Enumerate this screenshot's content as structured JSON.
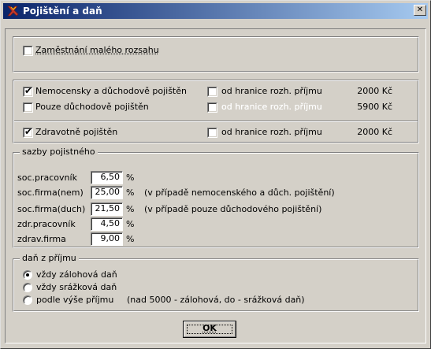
{
  "window": {
    "title": "Pojištění a daň",
    "close_label": "✕"
  },
  "small_scope": {
    "label": "Zaměstnání malého rozsahu",
    "checked": false
  },
  "insurance": {
    "sickness_pension": {
      "label": "Nemocensky a důchodově pojištěn",
      "checked": true
    },
    "sickness_threshold": {
      "label": "od hranice rozh. příjmu",
      "checked": false,
      "amount": "2000 Kč"
    },
    "pension_only": {
      "label": "Pouze důchodově pojištěn",
      "checked": false
    },
    "pension_threshold": {
      "label": "od hranice rozh. příjmu",
      "checked": false,
      "amount": "5900 Kč"
    },
    "health": {
      "label": "Zdravotně pojištěn",
      "checked": true
    },
    "health_threshold": {
      "label": "od hranice rozh. příjmu",
      "checked": false,
      "amount": "2000 Kč"
    }
  },
  "rates": {
    "legend": "sazby pojistného",
    "rows": [
      {
        "label": "soc.pracovník",
        "value": "6,50",
        "unit": "%",
        "note": ""
      },
      {
        "label": "soc.firma(nem)",
        "value": "25,00",
        "unit": "%",
        "note": "(v případě nemocenského a důch. pojištění)"
      },
      {
        "label": "soc.firma(duch)",
        "value": "21,50",
        "unit": "%",
        "note": "(v případě pouze důchodového pojištění)"
      },
      {
        "label": "zdr.pracovník",
        "value": "4,50",
        "unit": "%",
        "note": ""
      },
      {
        "label": "zdrav.firma",
        "value": "9,00",
        "unit": "%",
        "note": ""
      }
    ]
  },
  "income_tax": {
    "legend": "daň z příjmu",
    "options": [
      {
        "label": "vždy zálohová daň",
        "selected": true,
        "note": ""
      },
      {
        "label": "vždy srážková daň",
        "selected": false,
        "note": ""
      },
      {
        "label": "podle výše příjmu",
        "selected": false,
        "note": "(nad 5000 - zálohová, do - srážková daň)"
      }
    ]
  },
  "buttons": {
    "ok_label": "OK"
  }
}
